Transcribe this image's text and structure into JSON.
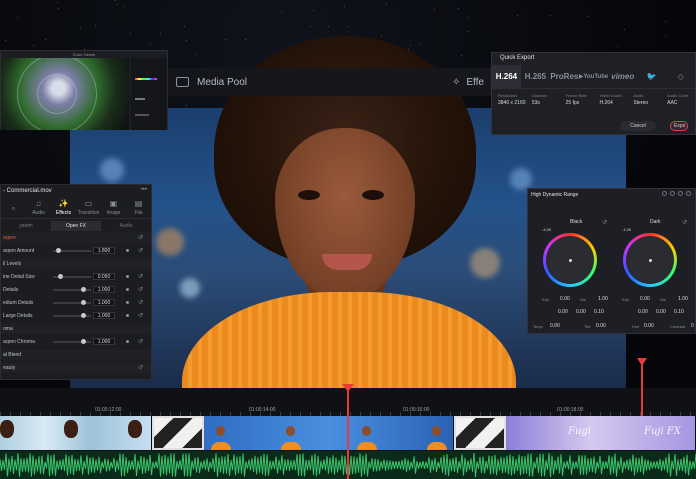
{
  "menu_bar": {
    "items": [
      {
        "label": "Media Pool",
        "icon": "media-pool-icon"
      },
      {
        "label": "Effe",
        "icon": "effects-icon"
      }
    ]
  },
  "scopes": {
    "title": "Color Viewer"
  },
  "inspector": {
    "title": "- Commercial.mov",
    "tabs": [
      {
        "label": "o",
        "icon": "video-icon"
      },
      {
        "label": "Audio",
        "icon": "music-note-icon"
      },
      {
        "label": "Effects",
        "icon": "effects-wand-icon",
        "active": true
      },
      {
        "label": "Transition",
        "icon": "transition-icon"
      },
      {
        "label": "Image",
        "icon": "image-icon"
      },
      {
        "label": "File",
        "icon": "file-icon"
      }
    ],
    "subtabs": [
      {
        "label": "ystem"
      },
      {
        "label": "Open FX",
        "active": true
      },
      {
        "label": "Audio"
      }
    ],
    "rows": [
      {
        "label": "arpen",
        "type": "section-red"
      },
      {
        "label": "arpen Amount",
        "value": "1.800",
        "knob": 0.1
      },
      {
        "label": "il Levels",
        "type": "section"
      },
      {
        "label": "ine Detail Size",
        "value": "0.050",
        "knob": 0.15
      },
      {
        "label": "Details",
        "value": "1.000",
        "knob": 0.82
      },
      {
        "label": "edium Details",
        "value": "1.000",
        "knob": 0.82
      },
      {
        "label": "Large Details",
        "value": "1.000",
        "knob": 0.82
      },
      {
        "label": "oma",
        "type": "section"
      },
      {
        "label": "arpen Chroma",
        "value": "1.000",
        "knob": 0.82
      },
      {
        "label": "al Blend",
        "type": "section"
      },
      {
        "label": "eauty",
        "type": "section-tools"
      }
    ]
  },
  "quick_export": {
    "title": "Quick Export",
    "tabs": [
      {
        "label": "H.264",
        "active": true
      },
      {
        "label": "H.265"
      },
      {
        "label": "ProRes"
      },
      {
        "label": "YouTube"
      },
      {
        "label": "vimeo"
      },
      {
        "label": "",
        "icon": "twitter-icon"
      },
      {
        "label": "",
        "icon": "dropbox-icon"
      }
    ],
    "specs": [
      {
        "key": "Resolution",
        "value": "3840 x 2160"
      },
      {
        "key": "Duration",
        "value": "53s"
      },
      {
        "key": "Frame Rate",
        "value": "25 fps"
      },
      {
        "key": "Video Codec",
        "value": "H.264"
      },
      {
        "key": "Audio",
        "value": "Stereo"
      },
      {
        "key": "Audio Code",
        "value": "AAC"
      }
    ],
    "cancel_label": "Cancel",
    "export_label": "Expo"
  },
  "hdr": {
    "title": "High Dynamic Range",
    "zones": [
      {
        "label": "Black",
        "exp_label": "Exp",
        "exp": "0.00",
        "sat_label": "Sat",
        "sat": "1.00",
        "x": "0.00",
        "y": "0.00",
        "z": "0.10",
        "side": "-4.00"
      },
      {
        "label": "Dark",
        "exp_label": "Exp",
        "exp": "0.00",
        "sat_label": "Sat",
        "sat": "1.00",
        "x": "0.00",
        "y": "0.00",
        "z": "0.10",
        "side": "-1.00"
      }
    ],
    "bottom": {
      "temp_label": "Temp",
      "temp": "0.00",
      "tint_label": "Tint",
      "tint": "0.00",
      "hue_label": "Hue",
      "hue": "0.00",
      "contrast_label": "Contrast",
      "contrast": "0"
    }
  },
  "timeline": {
    "timecodes": [
      "01:00:12:00",
      "01:00:14:00",
      "01:00:16:00",
      "01:00:18:00"
    ],
    "clip_text": [
      "Fugi",
      "Fuji FX"
    ]
  },
  "colors": {
    "accent_red": "#e53a3a",
    "shirt_orange": "#ef8f22",
    "panel_bg": "#1c1d21"
  }
}
